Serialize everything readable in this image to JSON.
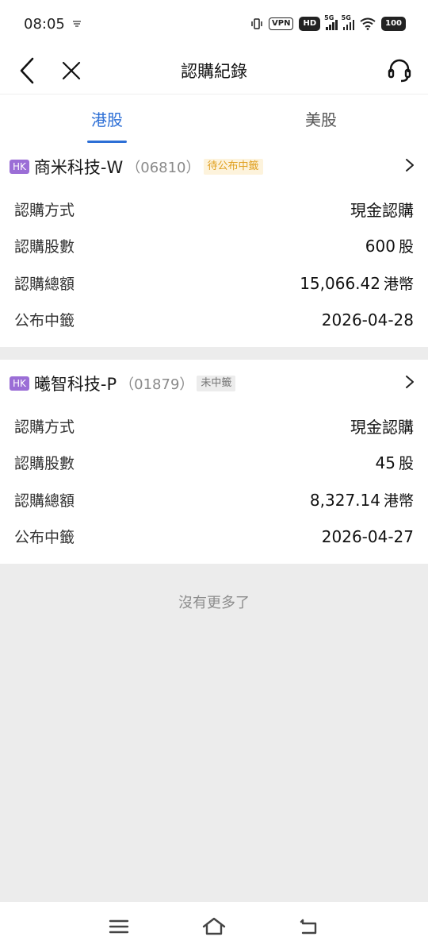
{
  "status_bar": {
    "time": "08:05",
    "vpn": "VPN",
    "hd": "HD",
    "net1": "5G",
    "net2": "5G",
    "battery": "100"
  },
  "header": {
    "title": "認購紀錄"
  },
  "tabs": [
    {
      "label": "港股",
      "active": true
    },
    {
      "label": "美股",
      "active": false
    }
  ],
  "records": [
    {
      "market": "HK",
      "name": "商米科技-W",
      "code": "（06810）",
      "status": "待公布中籤",
      "rows": [
        {
          "label": "認購方式",
          "value": "現金認購",
          "unit": ""
        },
        {
          "label": "認購股數",
          "value": "600",
          "unit": "股"
        },
        {
          "label": "認購總額",
          "value": "15,066.42",
          "unit": "港幣"
        },
        {
          "label": "公布中籤",
          "value": "2026-04-28",
          "unit": ""
        }
      ]
    },
    {
      "market": "HK",
      "name": "曦智科技-P",
      "code": "（01879）",
      "status": "未中籤",
      "rows": [
        {
          "label": "認購方式",
          "value": "現金認購",
          "unit": ""
        },
        {
          "label": "認購股數",
          "value": "45",
          "unit": "股"
        },
        {
          "label": "認購總額",
          "value": "8,327.14",
          "unit": "港幣"
        },
        {
          "label": "公布中籤",
          "value": "2026-04-27",
          "unit": ""
        }
      ]
    }
  ],
  "footer": {
    "no_more": "沒有更多了"
  },
  "colors": {
    "accent": "#2d6fd6",
    "hk_tag": "#9b6ed6",
    "pending": "#e0a020"
  }
}
